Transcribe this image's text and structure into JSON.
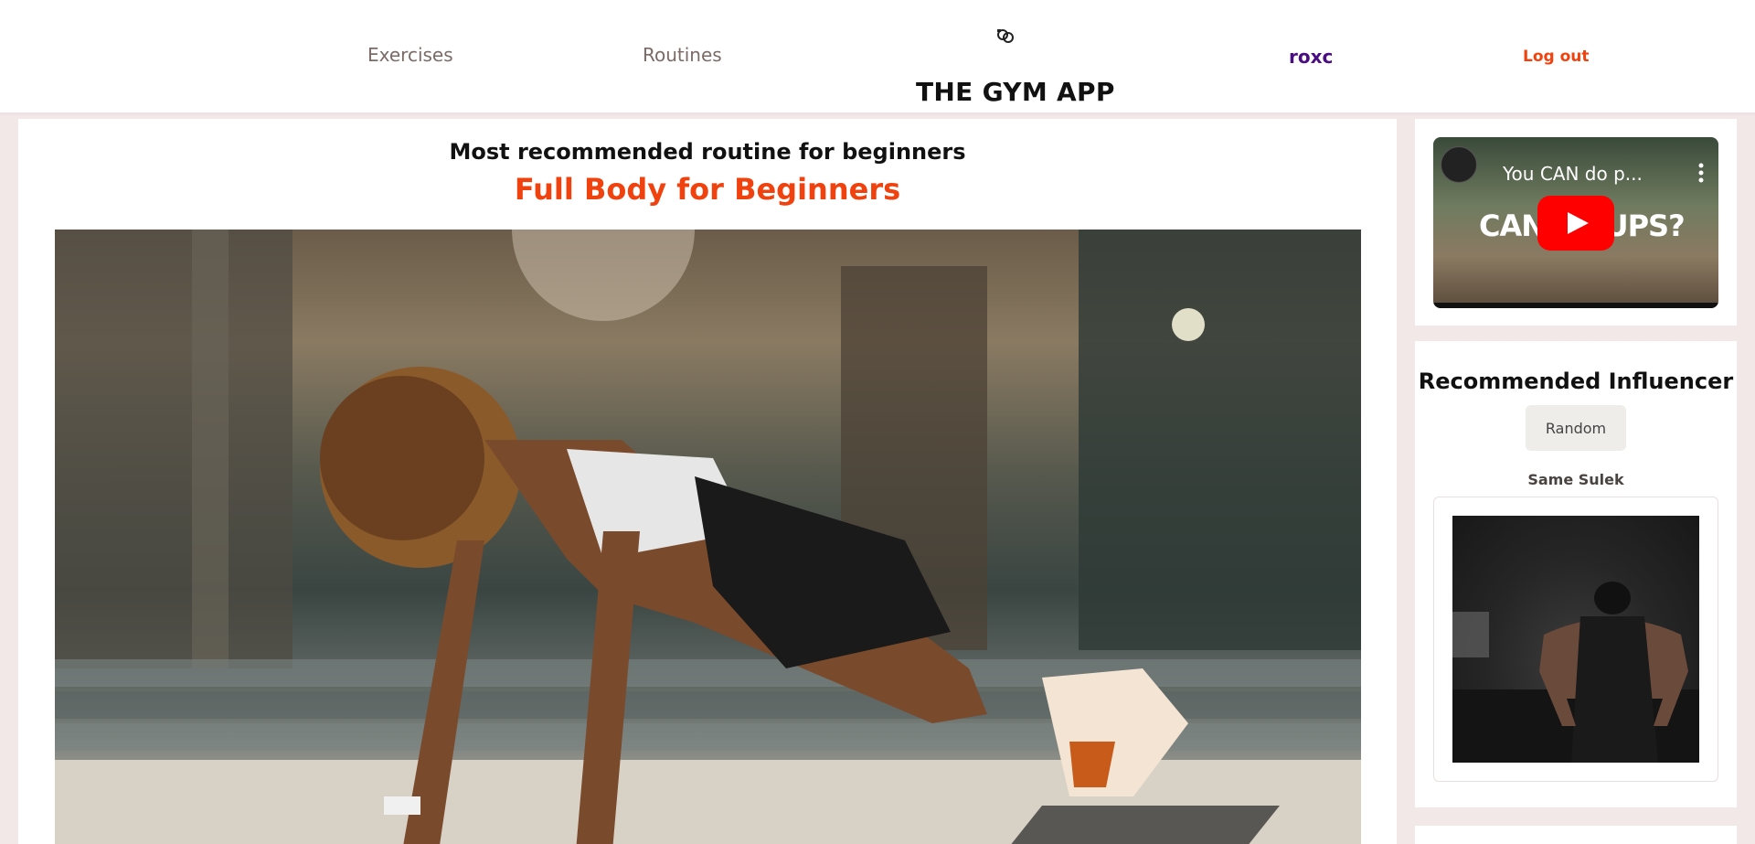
{
  "nav": {
    "exercises": "Exercises",
    "routines": "Routines",
    "app_title": "THE GYM APP",
    "username": "roxc",
    "logout": "Log out"
  },
  "main": {
    "subtitle": "Most recommended routine for beginners",
    "routine_title": "Full Body for Beginners"
  },
  "video": {
    "title": "You CAN do p...",
    "overlay_text": "CAN'T   HUPS?"
  },
  "influencer": {
    "heading": "Recommended Influencer",
    "random_button": "Random",
    "name": "Same Sulek"
  },
  "colors": {
    "accent": "#f0420e",
    "user": "#4a0d82",
    "page_bg": "#f2e8e8"
  },
  "icons": {
    "logo": "gym-logo-icon",
    "play": "youtube-play-icon",
    "menu": "more-vertical-icon"
  }
}
